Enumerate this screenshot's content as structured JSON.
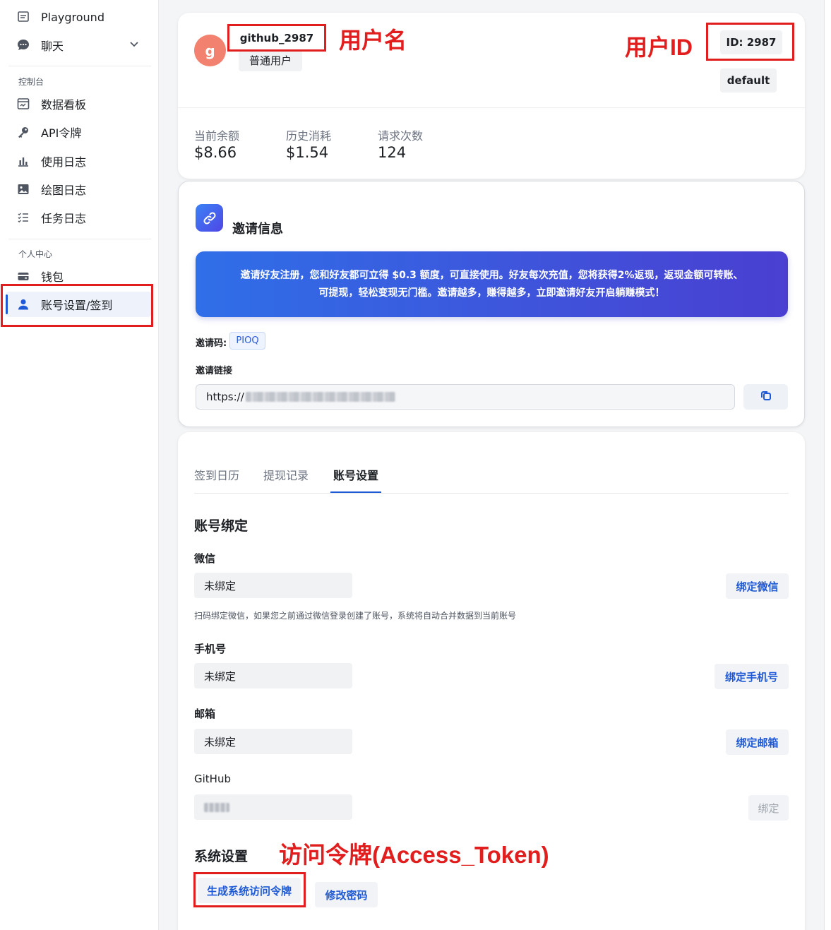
{
  "sidebar": {
    "top_items": [
      {
        "label": "Playground",
        "icon": "message-square-icon"
      },
      {
        "label": "聊天",
        "icon": "chat-bubble-icon"
      }
    ],
    "sections": [
      {
        "title": "控制台",
        "items": [
          {
            "label": "数据看板",
            "icon": "dashboard-icon"
          },
          {
            "label": "API令牌",
            "icon": "key-icon"
          },
          {
            "label": "使用日志",
            "icon": "bar-chart-icon"
          },
          {
            "label": "绘图日志",
            "icon": "image-icon"
          },
          {
            "label": "任务日志",
            "icon": "task-list-icon"
          }
        ]
      },
      {
        "title": "个人中心",
        "items": [
          {
            "label": "钱包",
            "icon": "wallet-icon"
          },
          {
            "label": "账号设置/签到",
            "icon": "user-icon",
            "active": true
          }
        ]
      }
    ]
  },
  "profile": {
    "avatar_letter": "g",
    "username": "github_2987",
    "role": "普通用户",
    "user_id": "ID: 2987",
    "group": "default"
  },
  "stats": [
    {
      "label": "当前余额",
      "value": "$8.66"
    },
    {
      "label": "历史消耗",
      "value": "$1.54"
    },
    {
      "label": "请求次数",
      "value": "124"
    }
  ],
  "invite": {
    "title": "邀请信息",
    "banner_line1": "邀请好友注册，您和好友都可立得 $0.3 额度，可直接使用。好友每次充值，您将获得2%返现，返现金额可转账、",
    "banner_line2": "可提现，轻松变现无门槛。邀请越多，赚得越多，立即邀请好友开启躺赚模式！",
    "code_label": "邀请码:",
    "code": "PIOQ",
    "link_label": "邀请链接",
    "link_prefix": "https://"
  },
  "tabs": [
    "签到日历",
    "提现记录",
    "账号设置"
  ],
  "account": {
    "binding_title": "账号绑定",
    "fields": [
      {
        "label": "微信",
        "value": "未绑定",
        "button": "绑定微信"
      },
      {
        "label": "手机号",
        "value": "未绑定",
        "button": "绑定手机号"
      },
      {
        "label": "邮箱",
        "value": "未绑定",
        "button": "绑定邮箱"
      },
      {
        "label": "GitHub",
        "value": "",
        "button": "绑定"
      }
    ],
    "wechat_hint": "扫码绑定微信，如果您之前通过微信登录创建了账号，系统将自动合并数据到当前账号",
    "system_title": "系统设置",
    "generate_token_button": "生成系统访问令牌",
    "change_password_button": "修改密码"
  },
  "annotations": {
    "username": "用户名",
    "user_id": "用户ID",
    "access_token": "访问令牌(Access_Token)"
  },
  "colors": {
    "annotation_red": "#e11d1d",
    "accent_blue": "#1f5ad6",
    "avatar_bg": "#f2826f"
  }
}
